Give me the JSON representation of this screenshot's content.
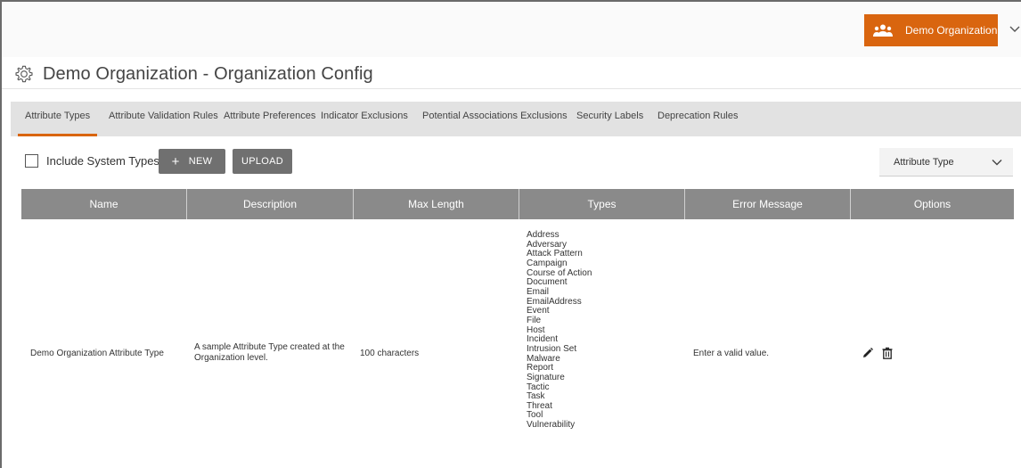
{
  "header": {
    "org_button_label": "Demo Organization",
    "org_icon": "users-icon",
    "accent_color": "#d9650f"
  },
  "page": {
    "title": "Demo Organization - Organization Config",
    "title_icon": "gear-icon"
  },
  "tabs": [
    {
      "label": "Attribute Types",
      "active": true
    },
    {
      "label": "Attribute Validation Rules",
      "active": false
    },
    {
      "label": "Attribute Preferences",
      "active": false
    },
    {
      "label": "Indicator Exclusions",
      "active": false
    },
    {
      "label": "Potential Associations Exclusions",
      "active": false
    },
    {
      "label": "Security Labels",
      "active": false
    },
    {
      "label": "Deprecation Rules",
      "active": false
    }
  ],
  "toolbar": {
    "include_system_types_label": "Include System Types",
    "include_system_types_checked": false,
    "new_label": "NEW",
    "upload_label": "UPLOAD",
    "filter_select_value": "Attribute Type"
  },
  "table": {
    "columns": [
      "Name",
      "Description",
      "Max Length",
      "Types",
      "Error Message",
      "Options"
    ],
    "rows": [
      {
        "name": "Demo Organization Attribute Type",
        "description": "A sample Attribute Type created at the Organization level.",
        "max_length": "100 characters",
        "types": [
          "Address",
          "Adversary",
          "Attack Pattern",
          "Campaign",
          "Course of Action",
          "Document",
          "Email",
          "EmailAddress",
          "Event",
          "File",
          "Host",
          "Incident",
          "Intrusion Set",
          "Malware",
          "Report",
          "Signature",
          "Tactic",
          "Task",
          "Threat",
          "Tool",
          "Vulnerability"
        ],
        "error_message": "Enter a valid value.",
        "options": [
          "edit-icon",
          "delete-icon"
        ]
      }
    ]
  }
}
